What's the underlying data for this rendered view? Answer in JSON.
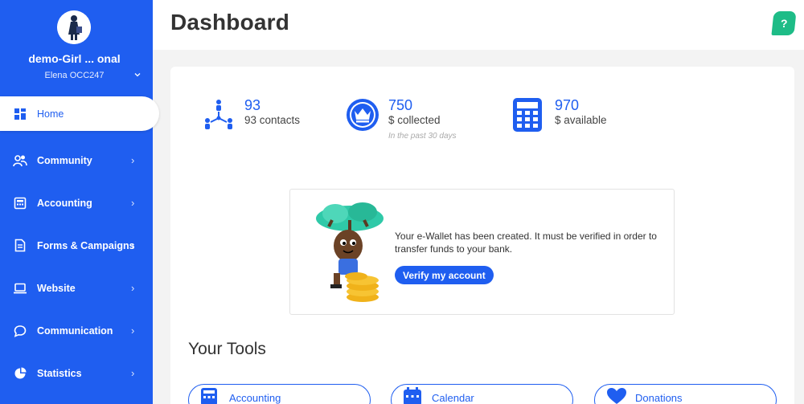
{
  "sidebar": {
    "org_name": "demo-Girl ... onal",
    "user_name": "Elena OCC247",
    "items": [
      {
        "label": "Home",
        "icon": "home-grid-icon"
      },
      {
        "label": "Community",
        "icon": "users-icon"
      },
      {
        "label": "Accounting",
        "icon": "calculator-icon"
      },
      {
        "label": "Forms & Campaigns",
        "icon": "document-icon"
      },
      {
        "label": "Website",
        "icon": "laptop-icon"
      },
      {
        "label": "Communication",
        "icon": "chat-icon"
      },
      {
        "label": "Statistics",
        "icon": "pie-chart-icon"
      }
    ]
  },
  "header": {
    "title": "Dashboard",
    "help_label": "?"
  },
  "stats": [
    {
      "value": "93",
      "label": "93 contacts",
      "sub": "",
      "icon": "contacts-network-icon"
    },
    {
      "value": "750",
      "label": "$ collected",
      "sub": "In the past 30 days",
      "icon": "crown-icon"
    },
    {
      "value": "970",
      "label": "$ available",
      "sub": "",
      "icon": "calculator-icon"
    }
  ],
  "wallet": {
    "message": "Your e-Wallet has been created. It must be verified in order to transfer funds to your bank.",
    "button_label": "Verify my account"
  },
  "tools": {
    "title": "Your Tools",
    "items": [
      {
        "label": "Accounting",
        "icon": "calculator-icon"
      },
      {
        "label": "Calendar",
        "icon": "calendar-icon"
      },
      {
        "label": "Donations",
        "icon": "heart-icon"
      }
    ]
  },
  "colors": {
    "brand_blue": "#1f5ef0",
    "help_green": "#1ebc87"
  }
}
